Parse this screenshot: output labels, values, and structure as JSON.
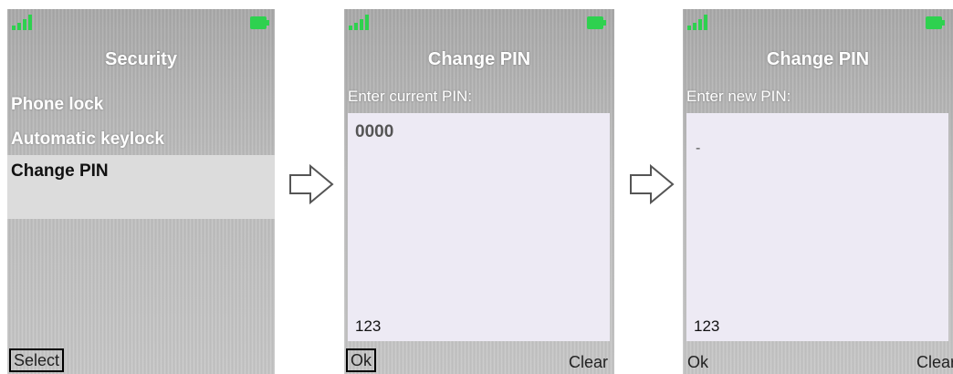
{
  "screen1": {
    "title": "Security",
    "items": [
      "Phone lock",
      "Automatic keylock",
      "Change PIN"
    ],
    "selected_index": 2,
    "left_softkey": "Select"
  },
  "screen2": {
    "title": "Change PIN",
    "prompt": "Enter current PIN:",
    "value": "0000",
    "input_mode": "123",
    "left_softkey": "Ok",
    "right_softkey": "Clear"
  },
  "screen3": {
    "title": "Change PIN",
    "prompt": "Enter new PIN:",
    "cursor": "-",
    "input_mode": "123",
    "left_softkey": "Ok",
    "right_softkey": "Clear"
  },
  "colors": {
    "battery": "#2ed14f",
    "signal": "#2ed14f",
    "entry_bg": "#edeaf4"
  }
}
